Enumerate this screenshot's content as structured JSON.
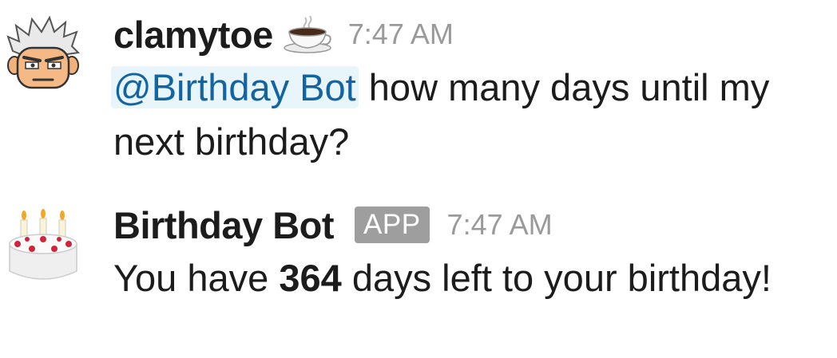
{
  "messages": [
    {
      "username": "clamytoe",
      "status_emoji": "coffee-cup-icon",
      "timestamp": "7:47 AM",
      "mention": "@Birthday Bot",
      "text": " how many days until my next birthday?"
    },
    {
      "username": "Birthday Bot",
      "badge": "APP",
      "timestamp": "7:47 AM",
      "text_before": "You have ",
      "text_bold": "364",
      "text_after": " days left to your birthday!"
    }
  ],
  "colors": {
    "mention_bg": "#e8f5fa",
    "mention_text": "#1264a3",
    "timestamp": "#9a9a9a",
    "badge_bg": "#9e9e9e"
  }
}
